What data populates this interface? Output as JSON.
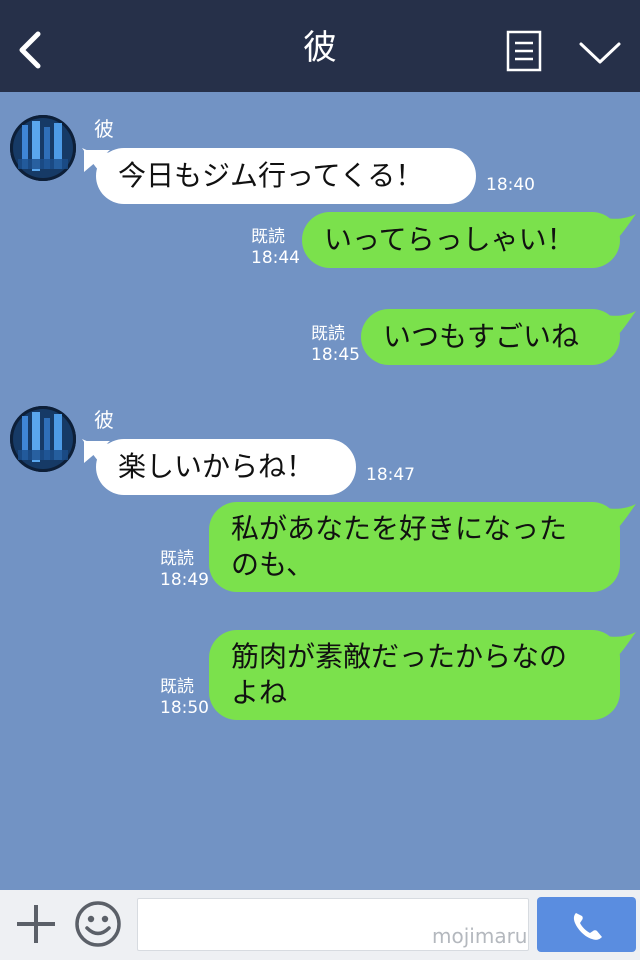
{
  "header": {
    "title": "彼",
    "back_icon": "chevron-left-icon",
    "menu_icon": "list-icon",
    "expand_icon": "chevron-down-icon",
    "background": "#263049"
  },
  "chat": {
    "background": "#7293c4",
    "read_label": "既読",
    "messages": [
      {
        "direction": "in",
        "sender": "彼",
        "text": "今日もジム行ってくる！",
        "time": "18:40"
      },
      {
        "direction": "out",
        "text": "いってらっしゃい！",
        "status": "既読",
        "time": "18:44"
      },
      {
        "direction": "out",
        "text": "いつもすごいね",
        "status": "既読",
        "time": "18:45"
      },
      {
        "direction": "in",
        "sender": "彼",
        "text": "楽しいからね！",
        "time": "18:47"
      },
      {
        "direction": "out",
        "text_lines": [
          "私があなたを好きになった",
          "のも、"
        ],
        "status": "既読",
        "time": "18:49"
      },
      {
        "direction": "out",
        "text_lines": [
          "筋肉が素敵だったからなの",
          "よね"
        ],
        "status": "既読",
        "time": "18:50"
      }
    ]
  },
  "footer": {
    "plus_icon": "plus-icon",
    "emoji_icon": "smiley-icon",
    "input_value": "",
    "watermark": "mojimaru",
    "call_icon": "phone-icon",
    "call_color": "#5a8de0"
  },
  "colors": {
    "incoming_bubble": "#ffffff",
    "outgoing_bubble": "#7be14c"
  }
}
